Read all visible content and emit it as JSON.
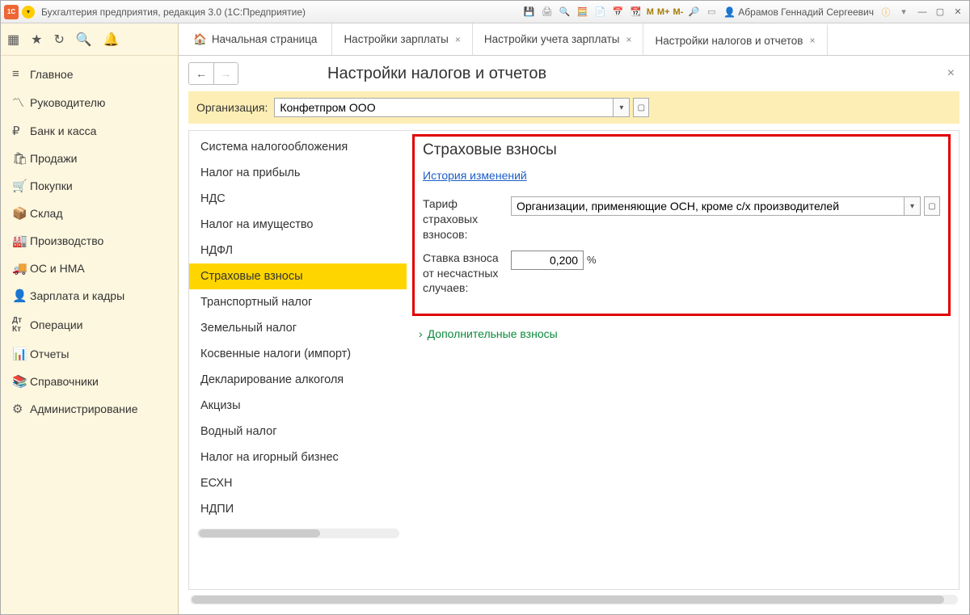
{
  "title_bar": {
    "app_title": "Бухгалтерия предприятия, редакция 3.0  (1С:Предприятие)",
    "memory_buttons": [
      "M",
      "M+",
      "M-"
    ],
    "user_name": "Абрамов Геннадий Сергеевич"
  },
  "sidebar": {
    "items": [
      {
        "icon": "≡",
        "label": "Главное"
      },
      {
        "icon": "📈",
        "label": "Руководителю"
      },
      {
        "icon": "₽",
        "label": "Банк и касса"
      },
      {
        "icon": "🛍",
        "label": "Продажи"
      },
      {
        "icon": "🛒",
        "label": "Покупки"
      },
      {
        "icon": "📦",
        "label": "Склад"
      },
      {
        "icon": "🏭",
        "label": "Производство"
      },
      {
        "icon": "🚚",
        "label": "ОС и НМА"
      },
      {
        "icon": "👤",
        "label": "Зарплата и кадры"
      },
      {
        "icon": "Дт",
        "label": "Операции"
      },
      {
        "icon": "📊",
        "label": "Отчеты"
      },
      {
        "icon": "📚",
        "label": "Справочники"
      },
      {
        "icon": "⚙",
        "label": "Администрирование"
      }
    ]
  },
  "tabs": {
    "home": "Начальная страница",
    "items": [
      {
        "label": "Настройки зарплаты"
      },
      {
        "label": "Настройки учета зарплаты"
      },
      {
        "label": "Настройки налогов и отчетов",
        "active": true
      }
    ]
  },
  "page": {
    "title": "Настройки налогов и отчетов",
    "org_label": "Организация:",
    "org_value": "Конфетпром ООО"
  },
  "settings_list": [
    "Система налогообложения",
    "Налог на прибыль",
    "НДС",
    "Налог на имущество",
    "НДФЛ",
    "Страховые взносы",
    "Транспортный налог",
    "Земельный налог",
    "Косвенные налоги (импорт)",
    "Декларирование алкоголя",
    "Акцизы",
    "Водный налог",
    "Налог на игорный бизнес",
    "ЕСХН",
    "НДПИ"
  ],
  "settings_selected_index": 5,
  "detail": {
    "title": "Страховые взносы",
    "history_link": "История изменений",
    "tariff_label": "Тариф страховых взносов:",
    "tariff_value": "Организации, применяющие ОСН, кроме с/х производителей",
    "rate_label": "Ставка взноса от несчастных случаев:",
    "rate_value": "0,200",
    "rate_unit": "%",
    "expander": "Дополнительные взносы"
  }
}
